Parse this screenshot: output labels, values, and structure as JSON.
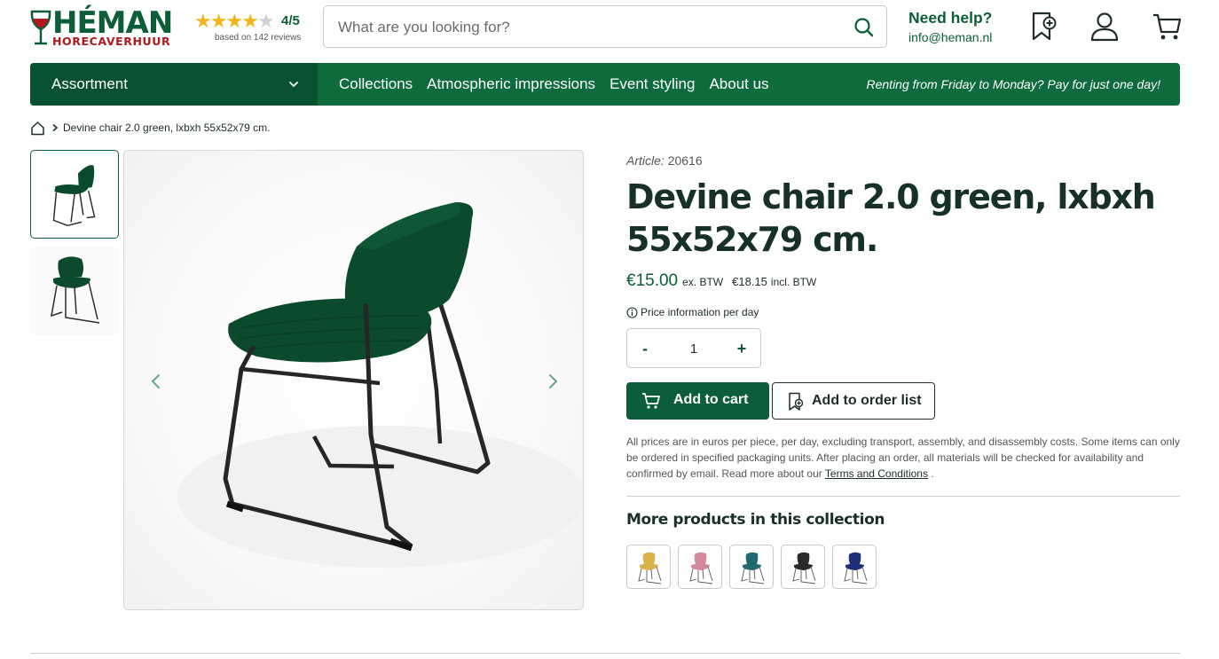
{
  "header": {
    "logo_name": "HÉMAN",
    "logo_sub": "HORECAVERHUUR",
    "rating": {
      "score": "4/5",
      "value": 4,
      "max": 5,
      "reviews_text": "based on 142 reviews"
    },
    "search_placeholder": "What are you looking for?",
    "help_title": "Need help?",
    "help_email": "info@heman.nl",
    "icons": [
      "search-icon",
      "order-list-icon",
      "account-icon",
      "cart-icon"
    ]
  },
  "nav": {
    "assortment": "Assortment",
    "links": [
      "Collections",
      "Atmospheric impressions",
      "Event styling",
      "About us"
    ],
    "promo": "Renting from Friday to Monday? Pay for just one day!"
  },
  "breadcrumb": {
    "current": "Devine chair 2.0 green, lxbxh 55x52x79 cm."
  },
  "gallery": {
    "thumbnails": 2,
    "active_thumbnail": 1
  },
  "product": {
    "article_label": "Article:",
    "article_number": "20616",
    "title": "Devine chair 2.0 green, lxbxh 55x52x79 cm.",
    "price_ex": "€15.00",
    "price_ex_label": "ex. BTW",
    "price_inc": "€18.15",
    "price_inc_label": "incl. BTW",
    "price_info": "Price information per day",
    "qty_minus": "-",
    "qty_plus": "+",
    "qty_value": "1",
    "add_to_cart": "Add to cart",
    "add_to_order_list": "Add to order list",
    "disclaimer_text": "All prices are in euros per piece, per day, excluding transport, assembly, and disassembly costs. Some items can only be ordered in specified packaging units. After placing an order, all materials will be checked for availability and confirmed by email. Read more about our ",
    "terms_link": "Terms and Conditions",
    "disclaimer_end": " ."
  },
  "collection": {
    "title": "More products in this collection",
    "variants": [
      {
        "name": "yellow",
        "color": "#d9b24a"
      },
      {
        "name": "pink",
        "color": "#d48a9d"
      },
      {
        "name": "teal",
        "color": "#1f6a6c"
      },
      {
        "name": "black",
        "color": "#2a2a2a"
      },
      {
        "name": "navy",
        "color": "#1f2f7a"
      }
    ]
  },
  "colors": {
    "brand_green": "#0b5e37",
    "brand_dark_green": "#095230",
    "brand_red": "#b0191e",
    "star": "#f2b51c",
    "chair": "#0c4a2c"
  }
}
